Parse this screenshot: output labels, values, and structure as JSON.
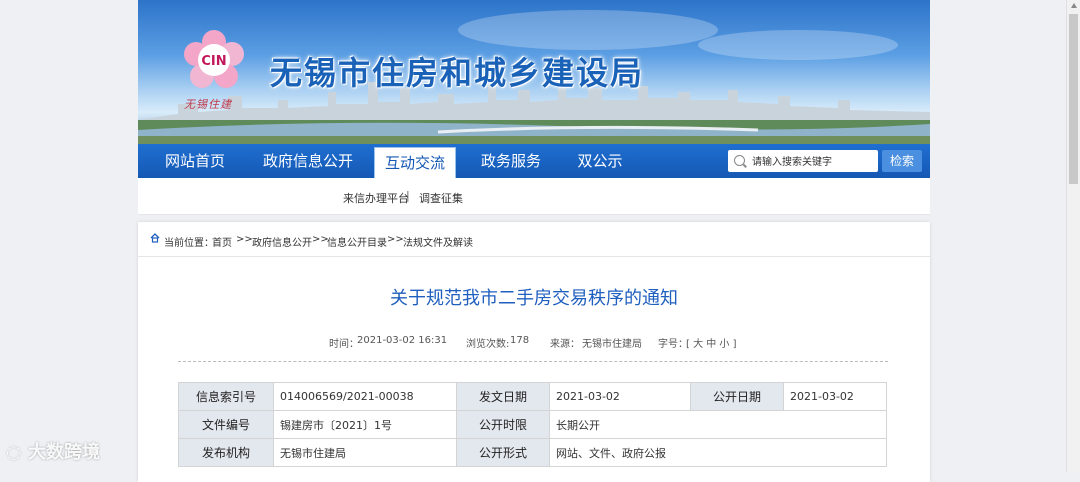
{
  "site": {
    "title": "无锡市住房和城乡建设局",
    "logo_mark": "CIN",
    "logo_caption": "无锡住建"
  },
  "nav": {
    "items": [
      "网站首页",
      "政府信息公开",
      "互动交流",
      "政务服务",
      "双公示"
    ],
    "active": "互动交流",
    "search_placeholder": "请输入搜索关键字",
    "search_button": "检索"
  },
  "subnav": {
    "items": [
      "来信办理平台",
      "调查征集"
    ],
    "separator": "|"
  },
  "breadcrumb": {
    "prefix": "当前位置：",
    "items": [
      "首页",
      "政府信息公开",
      "信息公开目录",
      "法规文件及解读"
    ],
    "separator": ">>"
  },
  "article": {
    "title": "关于规范我市二手房交易秩序的通知",
    "time_label": "时间：",
    "time": "2021-03-02 16:31",
    "views_label": "浏览次数:",
    "views": "178",
    "source_label": "来源：",
    "source": "无锡市住建局",
    "fontsize_label": "字号：",
    "fontsize_options": "[ 大 中 小 ]"
  },
  "info_table": {
    "rows": [
      [
        "信息索引号",
        "014006569/2021-00038",
        "发文日期",
        "2021-03-02",
        "公开日期",
        "2021-03-02"
      ],
      [
        "文件编号",
        "锡建房市〔2021〕1号",
        "公开时限",
        "长期公开"
      ],
      [
        "发布机构",
        "无锡市住建局",
        "公开形式",
        "网站、文件、政府公报"
      ]
    ]
  },
  "watermark": "大数跨境",
  "colors": {
    "nav_blue": "#1558b4",
    "title_blue": "#1a62b8",
    "label_bg": "#e3e7ee"
  }
}
